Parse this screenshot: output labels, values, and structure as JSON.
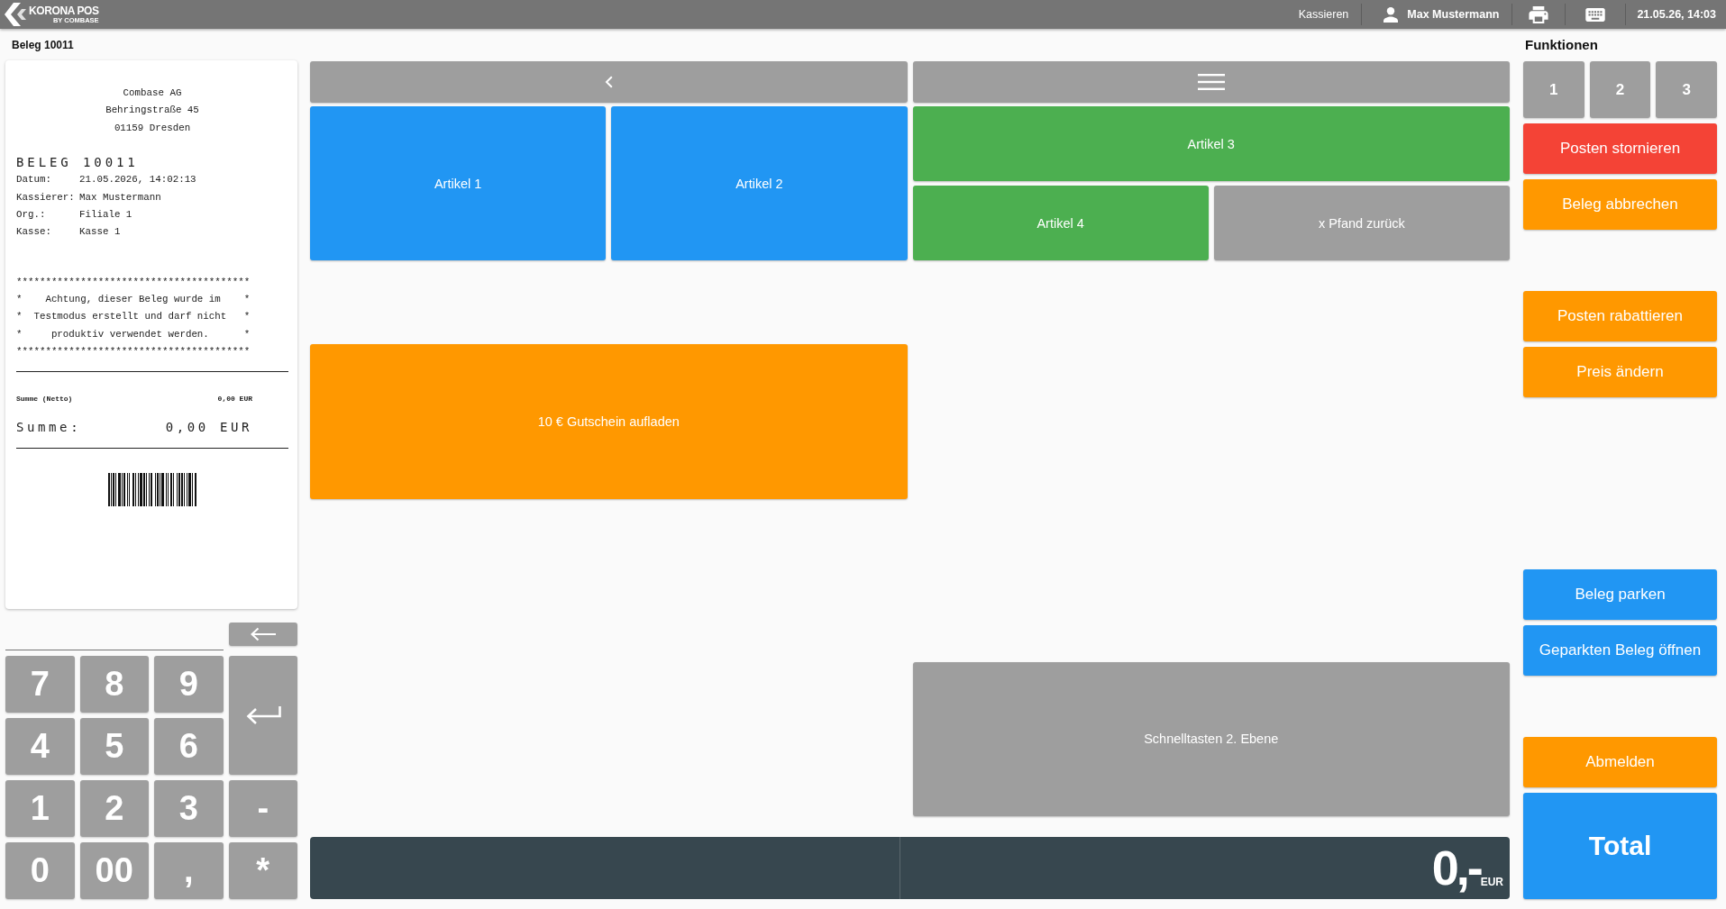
{
  "top_bar": {
    "logo": {
      "name": "KORONA POS",
      "tagline": "BY COMBASE"
    },
    "mode": "Kassieren",
    "user": "Max Mustermann",
    "datetime": "21.05.26, 14:03"
  },
  "receipt_panel": {
    "title": "Beleg 10011",
    "receipt": {
      "header": [
        "Combase AG",
        "Behringstraße 45",
        "01159 Dresden"
      ],
      "heading": "BELEG 10011",
      "fields": [
        {
          "label": "Datum:",
          "value": "21.05.2026, 14:02:13"
        },
        {
          "label": "Kassierer:",
          "value": "Max Mustermann"
        },
        {
          "label": "Org.:",
          "value": "Filiale 1"
        },
        {
          "label": "Kasse:",
          "value": "Kasse 1"
        }
      ],
      "notice": [
        "****************************************",
        "*    Achtung, dieser Beleg wurde im    *",
        "*  Testmodus erstellt und darf nicht   *",
        "*     produktiv verwendet werden.      *",
        "****************************************"
      ],
      "net_total": {
        "label": "Summe (Netto)",
        "value": "0,00 EUR"
      },
      "total": {
        "label": "Summe:",
        "value": "0,00 EUR"
      }
    }
  },
  "numpad": {
    "keys": [
      "7",
      "8",
      "9",
      "4",
      "5",
      "6",
      "1",
      "2",
      "3",
      "0",
      "00",
      ","
    ],
    "side_keys": [
      "-",
      "*"
    ]
  },
  "quick_keys": [
    {
      "label": "Artikel 1",
      "color": "#2196f3"
    },
    {
      "label": "Artikel 2",
      "color": "#2196f3"
    },
    {
      "label": "Artikel 3",
      "color": "#4caf50"
    },
    {
      "label": "Artikel 4",
      "color": "#4caf50"
    },
    {
      "label": "x Pfand zurück",
      "color": "#9e9e9e"
    },
    {
      "label": "10 € Gutschein aufladen",
      "color": "#ff9800"
    },
    {
      "label": "Schnelltasten 2. Ebene",
      "color": "#9e9e9e"
    }
  ],
  "display": {
    "amount": "0,-",
    "currency": "EUR"
  },
  "functions": {
    "title": "Funktionen",
    "pages": [
      "1",
      "2",
      "3"
    ],
    "buttons": [
      {
        "label": "Posten stornieren",
        "color": "#f44336",
        "kind": "action"
      },
      {
        "label": "Beleg abbrechen",
        "color": "#ff9800",
        "kind": "action"
      },
      {
        "label": "Posten rabattieren",
        "color": "#ff9800",
        "kind": "action"
      },
      {
        "label": "Preis ändern",
        "color": "#ff9800",
        "kind": "action"
      },
      {
        "label": "Beleg parken",
        "color": "#2196f3",
        "kind": "action"
      },
      {
        "label": "Geparkten Beleg öffnen",
        "color": "#2196f3",
        "kind": "action"
      },
      {
        "label": "Abmelden",
        "color": "#ff9800",
        "kind": "action"
      },
      {
        "label": "Total",
        "color": "#2196f3",
        "kind": "total"
      }
    ]
  }
}
